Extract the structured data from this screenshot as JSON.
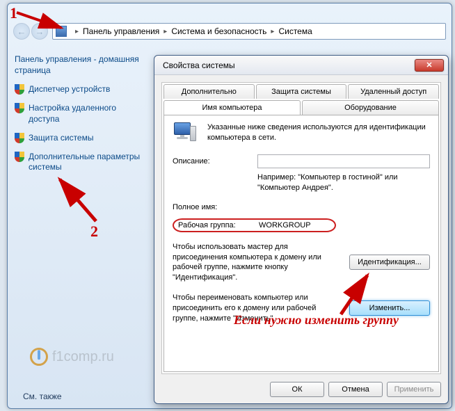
{
  "breadcrumb": {
    "seg1": "Панель управления",
    "seg2": "Система и безопасность",
    "seg3": "Система"
  },
  "sidebar": {
    "heading": "Панель управления - домашняя страница",
    "links": {
      "l0": "Диспетчер устройств",
      "l1": "Настройка удаленного доступа",
      "l2": "Защита системы",
      "l3": "Дополнительные параметры системы"
    },
    "see_also": "См. также"
  },
  "dialog": {
    "title": "Свойства системы",
    "tabs": {
      "t0": "Дополнительно",
      "t1": "Защита системы",
      "t2": "Удаленный доступ",
      "t3": "Имя компьютера",
      "t4": "Оборудование"
    },
    "intro": "Указанные ниже сведения используются для идентификации компьютера в сети.",
    "desc_label": "Описание:",
    "example": "Например: \"Компьютер в гостиной\" или \"Компьютер Андрея\".",
    "fullname_label": "Полное имя:",
    "workgroup_label": "Рабочая группа:",
    "workgroup_value": "WORKGROUP",
    "wizard_text": "Чтобы использовать мастер для присоединения компьютера к домену или рабочей группе, нажмите кнопку \"Идентификация\".",
    "ident_btn": "Идентификация...",
    "rename_text": "Чтобы переименовать компьютер или присоединить его к домену или рабочей группе, нажмите \"Изменить\".",
    "change_btn": "Изменить...",
    "ok": "ОК",
    "cancel": "Отмена",
    "apply": "Применить"
  },
  "annotations": {
    "n1": "1",
    "n2": "2",
    "note": "Если нужно изменить группу"
  },
  "watermark": "f1comp.ru"
}
